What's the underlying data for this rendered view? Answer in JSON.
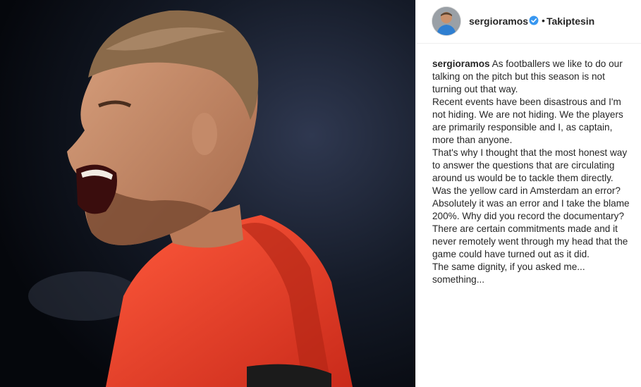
{
  "post": {
    "username": "sergioramos",
    "dot": "•",
    "follow_label": "Takiptesin",
    "caption_user": "sergioramos",
    "caption_lines": [
      "As footballers we like to do our talking on the pitch but this season is not turning out that way.",
      "Recent events have been disastrous and I'm not hiding. We are not hiding. We the players are primarily responsible and I, as captain, more than anyone.",
      "That's why I thought that the most honest way to answer the questions that are circulating around us would be to tackle them directly.",
      "Was the yellow card in Amsterdam an error?",
      "Absolutely it was an error and I take the blame 200%. Why did you record the documentary?",
      "There are certain commitments made and it never remotely went through my head that the game could have turned out as it did.",
      "The same dignity, if you asked me... something..."
    ]
  },
  "colors": {
    "jersey": "#e8422a",
    "verified": "#3897f0",
    "text": "#262626"
  },
  "icons": {
    "verified": "verified-badge-icon"
  }
}
